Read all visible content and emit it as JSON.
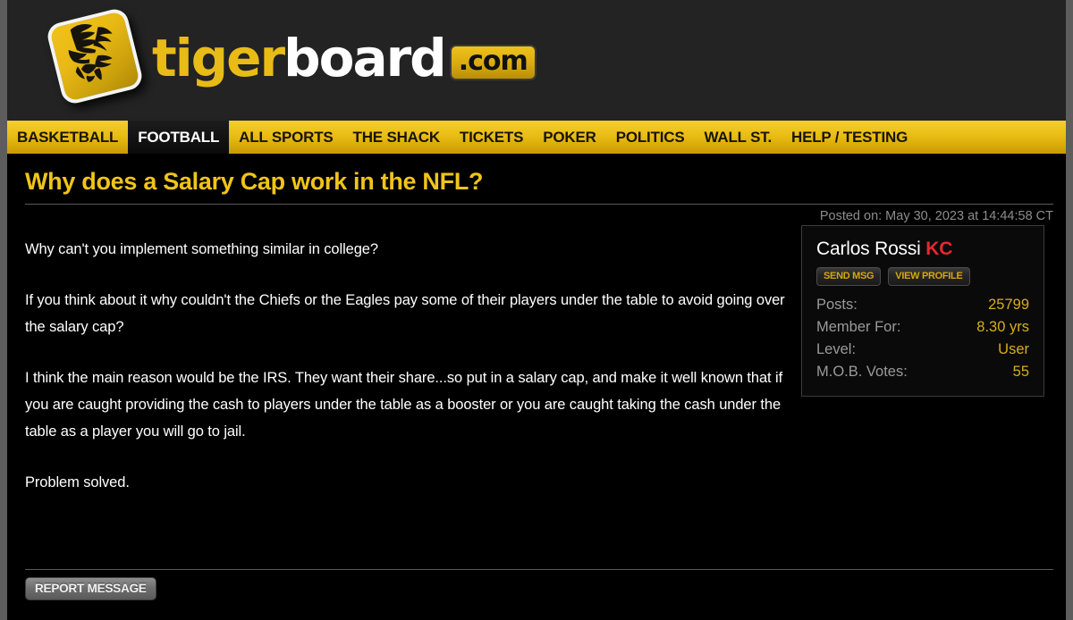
{
  "site": {
    "logo_icon": "tiger-head-logo",
    "wordmark_part1": "tiger",
    "wordmark_part2": "board",
    "wordmark_suffix": ".com",
    "brand_gold": "#e8bb16",
    "brand_dark": "#232323"
  },
  "nav": {
    "items": [
      {
        "label": "BASKETBALL",
        "active": false
      },
      {
        "label": "FOOTBALL",
        "active": true
      },
      {
        "label": "ALL SPORTS",
        "active": false
      },
      {
        "label": "THE SHACK",
        "active": false
      },
      {
        "label": "TICKETS",
        "active": false
      },
      {
        "label": "POKER",
        "active": false
      },
      {
        "label": "POLITICS",
        "active": false
      },
      {
        "label": "WALL ST.",
        "active": false
      },
      {
        "label": "HELP / TESTING",
        "active": false
      }
    ]
  },
  "thread": {
    "title": "Why does a Salary Cap work in the NFL?",
    "posted": "Posted on: May 30, 2023 at 14:44:58 CT",
    "title_color": "#f0c419"
  },
  "post": {
    "paragraphs": [
      "Why can't you implement something similar in college?",
      "If you think about it why couldn't the Chiefs or the Eagles pay some of their players under the table to avoid going over the salary cap?",
      "I think the main reason would be the IRS. They want their share...so put in a salary cap, and make it well known that if you are caught providing the cash to players under the table as a booster or you are caught taking the cash under the table as a player you will go to jail.",
      "Problem solved."
    ]
  },
  "user_card": {
    "display_name": "Carlos Rossi",
    "name_tag": "KC",
    "name_tag_color": "#e8262f",
    "buttons": [
      {
        "label": "SEND MSG"
      },
      {
        "label": "VIEW PROFILE"
      }
    ],
    "stats": [
      {
        "label": "Posts:",
        "value": "25799"
      },
      {
        "label": "Member For:",
        "value": "8.30 yrs"
      },
      {
        "label": "Level:",
        "value": "User"
      },
      {
        "label": "M.O.B. Votes:",
        "value": "55"
      }
    ]
  },
  "footer": {
    "report_label": "REPORT MESSAGE"
  }
}
